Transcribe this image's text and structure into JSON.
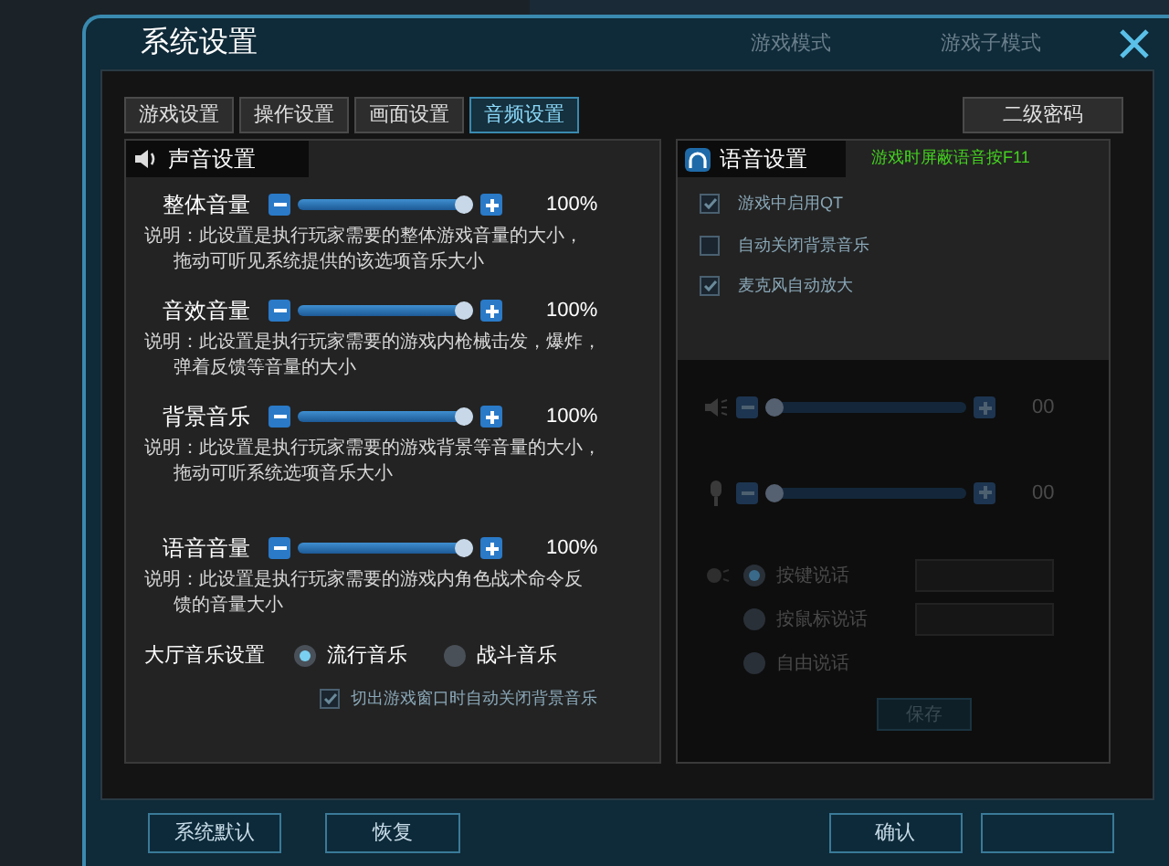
{
  "background": {
    "labels": [
      "游戏模式",
      "游戏子模式"
    ]
  },
  "window": {
    "title": "系统设置"
  },
  "tabs": [
    {
      "label": "游戏设置",
      "selected": false
    },
    {
      "label": "操作设置",
      "selected": false
    },
    {
      "label": "画面设置",
      "selected": false
    },
    {
      "label": "音频设置",
      "selected": true
    }
  ],
  "secondary_password_button": "二级密码",
  "sound_settings": {
    "title": "声音设置",
    "sliders": [
      {
        "name": "整体音量",
        "level": 1,
        "reading": "100%",
        "note": "说明：此设置是执行玩家需要的整体游戏音量的大小，",
        "note_2": "拖动可听见系统提供的该选项音乐大小"
      },
      {
        "name": "音效音量",
        "level": 1,
        "reading": "100%",
        "note": "说明：此设置是执行玩家需要的游戏内枪械击发，爆炸，",
        "note_2": "弹着反馈等音量的大小"
      },
      {
        "name": "背景音乐",
        "level": 1,
        "reading": "100%",
        "note": "说明：此设置是执行玩家需要的游戏背景等音量的大小，",
        "note_2": "拖动可听系统选项音乐大小"
      },
      {
        "name": "语音音量",
        "level": 1,
        "reading": "100%",
        "note": "说明：此设置是执行玩家需要的游戏内角色战术命令反",
        "note_2": "馈的音量大小"
      }
    ],
    "lobby_music": {
      "label": "大厅音乐设置",
      "options": [
        {
          "label": "流行音乐",
          "selected": true
        },
        {
          "label": "战斗音乐",
          "selected": false
        }
      ]
    },
    "auto_mute": {
      "label": "切出游戏窗口时自动关闭背景音乐",
      "checked": true
    }
  },
  "voice_settings": {
    "title": "语音设置",
    "hint": "游戏时屏蔽语音按F11",
    "options": [
      {
        "label": "游戏中启用QT",
        "checked": true
      },
      {
        "label": "自动关闭背景音乐",
        "checked": false
      },
      {
        "label": "麦克风自动放大",
        "checked": true
      }
    ],
    "sliders": [
      {
        "kind": "speaker",
        "level": 0,
        "reading": "00",
        "disabled": true
      },
      {
        "kind": "microphone",
        "level": 0,
        "reading": "00",
        "disabled": true
      }
    ],
    "talk_modes": [
      {
        "label": "按键说话",
        "selected": true,
        "kind": "hotkey"
      },
      {
        "label": "按鼠标说话",
        "selected": false,
        "kind": "hotkey"
      },
      {
        "label": "自由说话",
        "selected": false,
        "kind": "plain"
      }
    ],
    "save_button": {
      "label": "保存",
      "disabled": true
    }
  },
  "footer": {
    "buttons": [
      {
        "label": "系统默认"
      },
      {
        "label": "恢复"
      },
      {
        "label": "确认"
      }
    ]
  }
}
